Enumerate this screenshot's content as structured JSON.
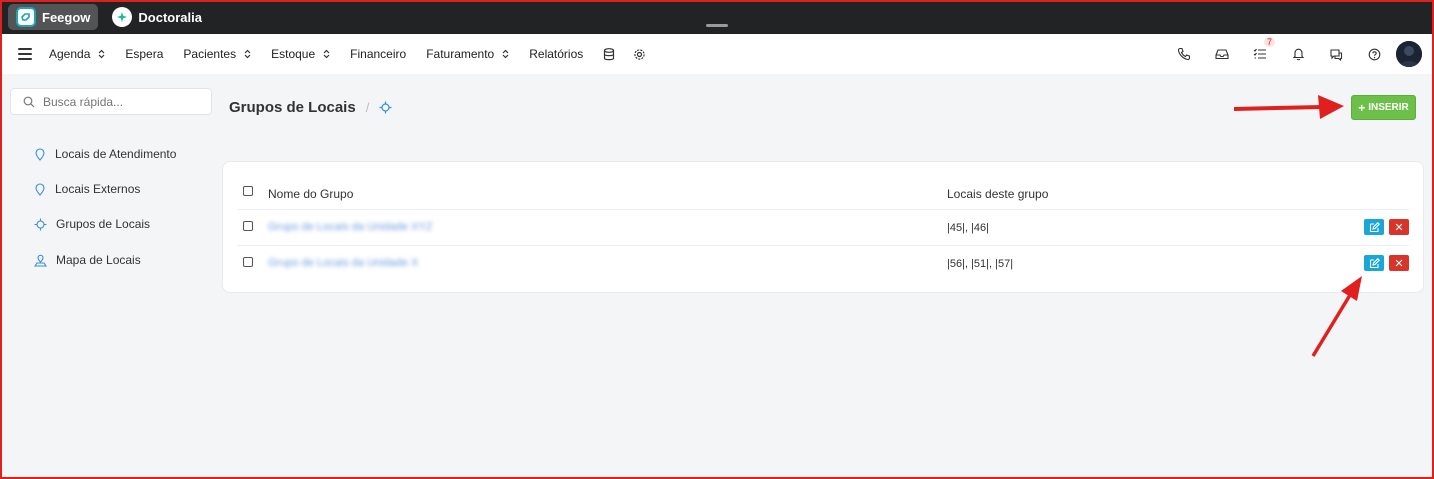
{
  "topbar": {
    "tabs": [
      {
        "label": "Feegow",
        "active": true
      },
      {
        "label": "Doctoralia",
        "active": false
      }
    ]
  },
  "nav": {
    "items": [
      "Agenda",
      "Espera",
      "Pacientes",
      "Estoque",
      "Financeiro",
      "Faturamento",
      "Relatórios"
    ],
    "notification_count": "7"
  },
  "sidebar": {
    "search_placeholder": "Busca rápida...",
    "items": [
      "Locais de Atendimento",
      "Locais Externos",
      "Grupos de Locais",
      "Mapa de Locais"
    ]
  },
  "main": {
    "title": "Grupos de Locais",
    "insert_label": "INSERIR",
    "table": {
      "headers": [
        "Nome do Grupo",
        "Locais deste grupo"
      ],
      "rows": [
        {
          "name": "Grupo de Locais da Unidade XYZ",
          "locais": "|45|, |46|"
        },
        {
          "name": "Grupo de Locais da Unidade X",
          "locais": "|56|, |51|, |57|"
        }
      ]
    }
  },
  "colors": {
    "accent_green": "#6cc04a",
    "edit_blue": "#1aa7d8",
    "delete_red": "#d9342b",
    "annotation_red": "#e0201f"
  }
}
